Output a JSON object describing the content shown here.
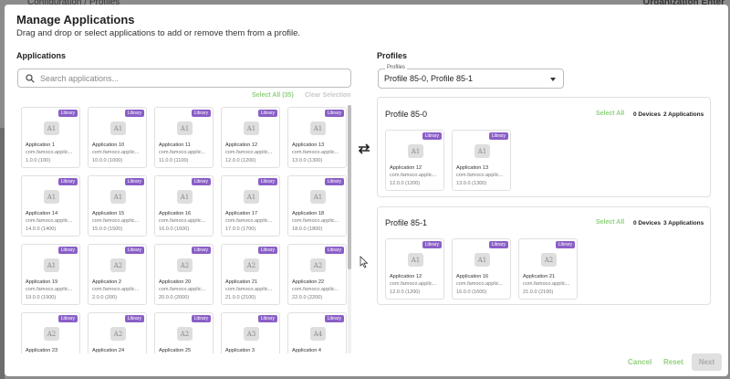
{
  "background": {
    "breadcrumb": "Configuration  /  Profiles",
    "org_label": "Organization Enter"
  },
  "modal": {
    "title": "Manage Applications",
    "subtitle": "Drag and drop or select applications to add or remove them from a profile."
  },
  "applications": {
    "heading": "Applications",
    "search_placeholder": "Search applications...",
    "select_all": "Select All (35)",
    "clear_selection": "Clear Selection",
    "items": [
      {
        "avatar": "A1",
        "name": "Application 1",
        "pkg": "com.famoco.applic...",
        "ver": "1.0.0 (100)",
        "badge": "Library"
      },
      {
        "avatar": "A1",
        "name": "Application 10",
        "pkg": "com.famoco.applic...",
        "ver": "10.0.0 (1000)",
        "badge": "Library"
      },
      {
        "avatar": "A1",
        "name": "Application 11",
        "pkg": "com.famoco.applic...",
        "ver": "11.0.0 (1100)",
        "badge": "Library"
      },
      {
        "avatar": "A1",
        "name": "Application 12",
        "pkg": "com.famoco.applic...",
        "ver": "12.0.0 (1200)",
        "badge": "Library"
      },
      {
        "avatar": "A1",
        "name": "Application 13",
        "pkg": "com.famoco.applic...",
        "ver": "13.0.0 (1300)",
        "badge": "Library"
      },
      {
        "avatar": "A1",
        "name": "Application 14",
        "pkg": "com.famoco.applic...",
        "ver": "14.0.0 (1400)",
        "badge": "Library"
      },
      {
        "avatar": "A1",
        "name": "Application 15",
        "pkg": "com.famoco.applic...",
        "ver": "15.0.0 (1500)",
        "badge": "Library"
      },
      {
        "avatar": "A1",
        "name": "Application 16",
        "pkg": "com.famoco.applic...",
        "ver": "16.0.0 (1600)",
        "badge": "Library"
      },
      {
        "avatar": "A1",
        "name": "Application 17",
        "pkg": "com.famoco.applic...",
        "ver": "17.0.0 (1700)",
        "badge": "Library"
      },
      {
        "avatar": "A1",
        "name": "Application 18",
        "pkg": "com.famoco.applic...",
        "ver": "18.0.0 (1800)",
        "badge": "Library"
      },
      {
        "avatar": "A1",
        "name": "Application 19",
        "pkg": "com.famoco.applic...",
        "ver": "19.0.0 (1900)",
        "badge": "Library"
      },
      {
        "avatar": "A2",
        "name": "Application 2",
        "pkg": "com.famoco.applic...",
        "ver": "2.0.0 (200)",
        "badge": "Library"
      },
      {
        "avatar": "A2",
        "name": "Application 20",
        "pkg": "com.famoco.applic...",
        "ver": "20.0.0 (2000)",
        "badge": "Library"
      },
      {
        "avatar": "A2",
        "name": "Application 21",
        "pkg": "com.famoco.applic...",
        "ver": "21.0.0 (2100)",
        "badge": "Library"
      },
      {
        "avatar": "A2",
        "name": "Application 22",
        "pkg": "com.famoco.applic...",
        "ver": "22.0.0 (2200)",
        "badge": "Library"
      },
      {
        "avatar": "A2",
        "name": "Application 23",
        "pkg": "com.famoco.applic...",
        "ver": "23.0.0 (2300)",
        "badge": "Library"
      },
      {
        "avatar": "A2",
        "name": "Application 24",
        "pkg": "com.famoco.applic...",
        "ver": "24.0.0 (2400)",
        "badge": "Library"
      },
      {
        "avatar": "A2",
        "name": "Application 25",
        "pkg": "com.famoco.applic...",
        "ver": "25.0.0 (2500)",
        "badge": "Library"
      },
      {
        "avatar": "A3",
        "name": "Application 3",
        "pkg": "com.famoco.applic...",
        "ver": "3.0.0 (300)",
        "badge": "Library"
      },
      {
        "avatar": "A4",
        "name": "Application 4",
        "pkg": "com.famoco.applic...",
        "ver": "4.0.0 (400)",
        "badge": "Library"
      }
    ]
  },
  "profiles": {
    "heading": "Profiles",
    "select_label": "Profiles",
    "select_value": "Profile 85-0, Profile 85-1",
    "items": [
      {
        "title": "Profile 85-0",
        "select_all": "Select All",
        "devices": "0 Devices",
        "applications": "2 Applications",
        "apps": [
          {
            "avatar": "A1",
            "name": "Application 12",
            "pkg": "com.famoco.applic...",
            "ver": "12.0.0 (1200)",
            "badge": "Library"
          },
          {
            "avatar": "A1",
            "name": "Application 13",
            "pkg": "com.famoco.applic...",
            "ver": "13.0.0 (1300)",
            "badge": "Library"
          }
        ]
      },
      {
        "title": "Profile 85-1",
        "select_all": "Select All",
        "devices": "0 Devices",
        "applications": "3 Applications",
        "apps": [
          {
            "avatar": "A1",
            "name": "Application 12",
            "pkg": "com.famoco.applic...",
            "ver": "12.0.0 (1200)",
            "badge": "Library"
          },
          {
            "avatar": "A1",
            "name": "Application 16",
            "pkg": "com.famoco.applic...",
            "ver": "16.0.0 (1600)",
            "badge": "Library"
          },
          {
            "avatar": "A2",
            "name": "Application 21",
            "pkg": "com.famoco.applic...",
            "ver": "21.0.0 (2100)",
            "badge": "Library"
          }
        ]
      }
    ]
  },
  "footer": {
    "cancel": "Cancel",
    "reset": "Reset",
    "next": "Next"
  },
  "colors": {
    "accent_green": "#8fd17d",
    "badge_purple": "#8a5fc7"
  }
}
